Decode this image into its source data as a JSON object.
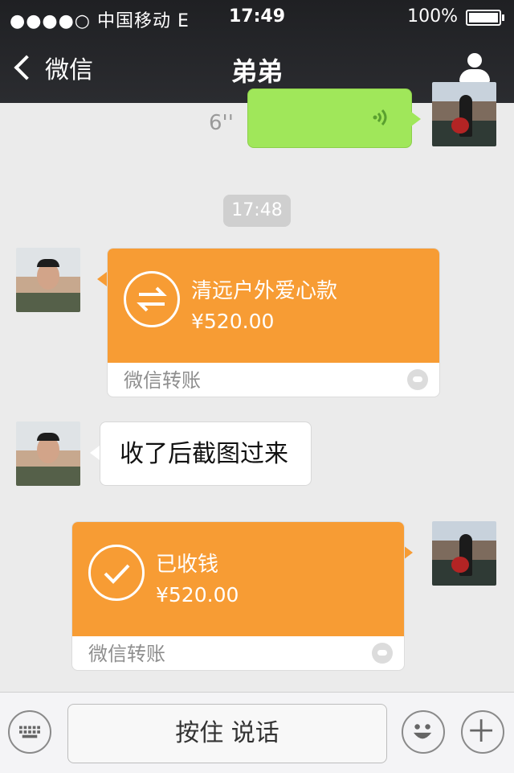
{
  "status_bar": {
    "signal_text": "●●●●○ 中国移动  E",
    "time": "17:49",
    "battery_text": "100%"
  },
  "nav": {
    "back_label": "微信",
    "title": "弟弟"
  },
  "messages": {
    "voice": {
      "duration": "6''"
    },
    "timestamp": "17:48",
    "transfer_incoming": {
      "title": "清远户外爱心款",
      "amount": "¥520.00",
      "footer": "微信转账"
    },
    "text": "收了后截图过来",
    "transfer_received": {
      "title": "已收钱",
      "amount": "¥520.00",
      "footer": "微信转账"
    }
  },
  "input_bar": {
    "hold_to_talk": "按住 说话"
  },
  "colors": {
    "voice_bubble": "#a0e75a",
    "transfer": "#f79c34",
    "header": "#2b2c30"
  }
}
